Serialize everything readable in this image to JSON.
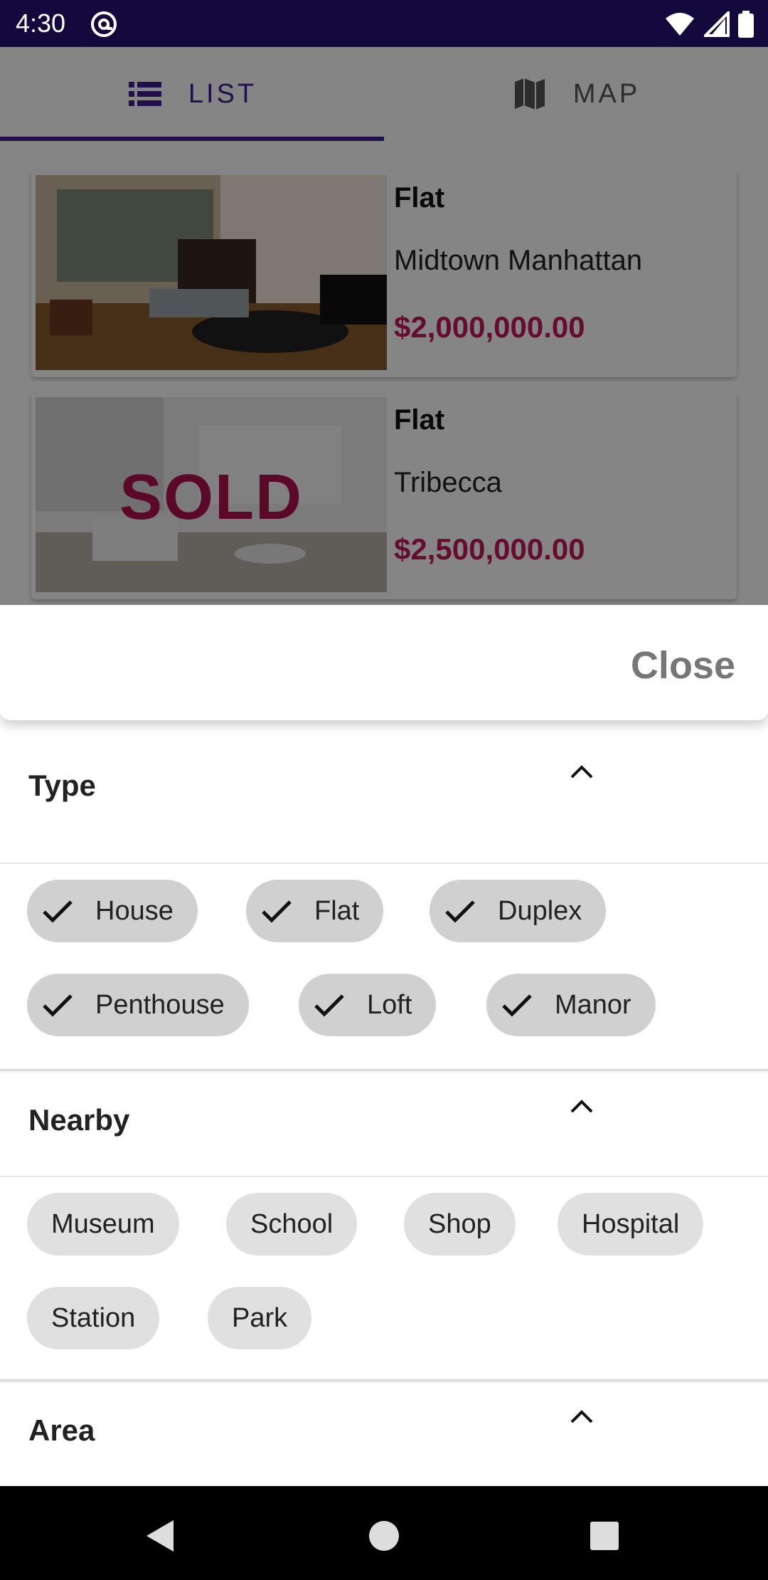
{
  "status_bar": {
    "time": "4:30",
    "app_icon": "at-sign-icon",
    "icons": [
      "wifi-icon",
      "cell-signal-icon",
      "battery-icon"
    ]
  },
  "tabs": [
    {
      "label": "LIST",
      "icon": "list-icon",
      "selected": true
    },
    {
      "label": "MAP",
      "icon": "map-icon",
      "selected": false
    }
  ],
  "listings": [
    {
      "type": "Flat",
      "location": "Midtown Manhattan",
      "price": "$2,000,000.00",
      "sold": false
    },
    {
      "type": "Flat",
      "location": "Tribecca",
      "price": "$2,500,000.00",
      "sold": true,
      "sold_label": "SOLD"
    }
  ],
  "sheet": {
    "close_label": "Close",
    "sections": [
      {
        "title": "Type",
        "expanded": true,
        "chips": [
          {
            "label": "House",
            "selected": true
          },
          {
            "label": "Flat",
            "selected": true
          },
          {
            "label": "Duplex",
            "selected": true
          },
          {
            "label": "Penthouse",
            "selected": true
          },
          {
            "label": "Loft",
            "selected": true
          },
          {
            "label": "Manor",
            "selected": true
          }
        ]
      },
      {
        "title": "Nearby",
        "expanded": true,
        "chips": [
          {
            "label": "Museum",
            "selected": false
          },
          {
            "label": "School",
            "selected": false
          },
          {
            "label": "Shop",
            "selected": false
          },
          {
            "label": "Hospital",
            "selected": false
          },
          {
            "label": "Station",
            "selected": false
          },
          {
            "label": "Park",
            "selected": false
          }
        ]
      },
      {
        "title": "Area",
        "expanded": true,
        "chips": []
      }
    ]
  },
  "nav_bar": {
    "icons": [
      "back-icon",
      "home-icon",
      "recents-icon"
    ]
  },
  "colors": {
    "primary": "#3f1d8f",
    "price": "#c2185b",
    "status_bar": "#14093d"
  }
}
